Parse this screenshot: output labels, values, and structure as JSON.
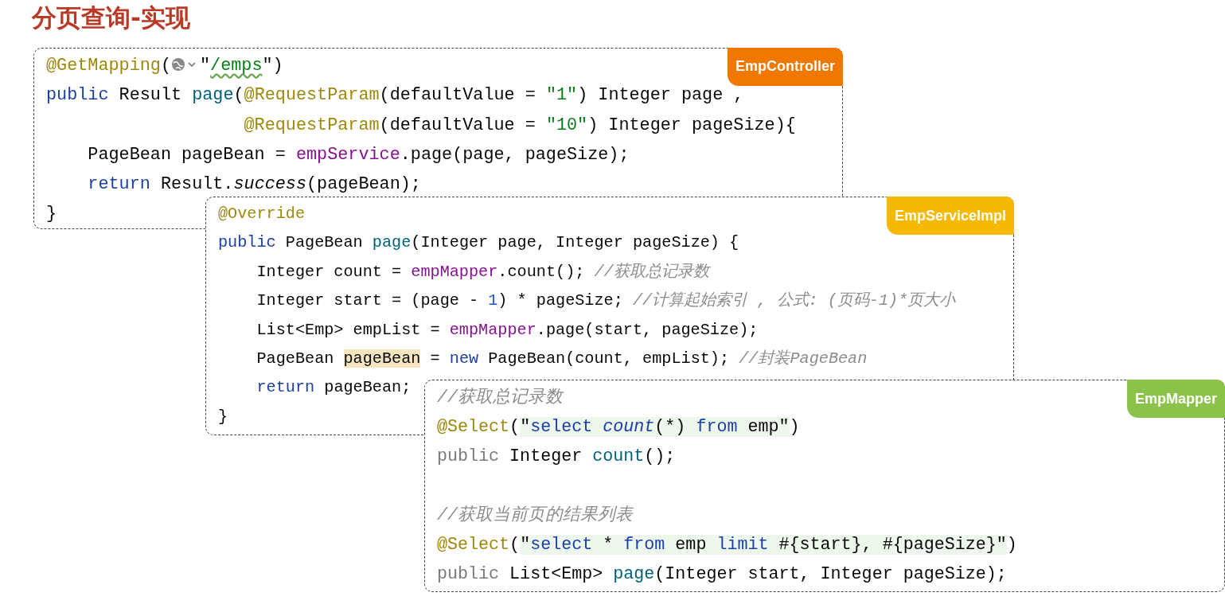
{
  "title": "分页查询-实现",
  "panels": [
    {
      "tag": "EmpController",
      "color": "#f07800",
      "lines": [
        {
          "kind": "code",
          "tokens": [
            {
              "kind": "ann",
              "text": "@GetMapping"
            },
            {
              "kind": "plain",
              "text": "("
            },
            {
              "kind": "globe"
            },
            {
              "kind": "plain",
              "text": "\""
            },
            {
              "kind": "url",
              "text": "/emps"
            },
            {
              "kind": "plain",
              "text": "\")"
            }
          ]
        },
        {
          "kind": "code",
          "tokens": [
            {
              "kind": "kw",
              "text": "public"
            },
            {
              "kind": "plain",
              "text": " Result "
            },
            {
              "kind": "fn",
              "text": "page"
            },
            {
              "kind": "plain",
              "text": "("
            },
            {
              "kind": "ann",
              "text": "@RequestParam"
            },
            {
              "kind": "plain",
              "text": "(defaultValue = "
            },
            {
              "kind": "str",
              "text": "\"1\""
            },
            {
              "kind": "plain",
              "text": ") Integer page ,"
            }
          ]
        },
        {
          "kind": "code",
          "tokens": [
            {
              "kind": "ann",
              "text": "                   @RequestParam"
            },
            {
              "kind": "plain",
              "text": "(defaultValue = "
            },
            {
              "kind": "str",
              "text": "\"10\""
            },
            {
              "kind": "plain",
              "text": ") Integer pageSize){"
            }
          ]
        },
        {
          "kind": "code",
          "tokens": [
            {
              "kind": "plain",
              "text": "    PageBean pageBean = "
            },
            {
              "kind": "field",
              "text": "empService"
            },
            {
              "kind": "plain",
              "text": ".page(page, pageSize);"
            }
          ]
        },
        {
          "kind": "code",
          "tokens": [
            {
              "kind": "kw",
              "text": "    return"
            },
            {
              "kind": "plain",
              "text": " Result."
            },
            {
              "kind": "italic",
              "text": "success"
            },
            {
              "kind": "plain",
              "text": "(pageBean);"
            }
          ]
        },
        {
          "kind": "code",
          "tokens": [
            {
              "kind": "plain",
              "text": "}"
            }
          ]
        }
      ]
    },
    {
      "tag": "EmpServiceImpl",
      "color": "#f6b800",
      "lines": [
        {
          "kind": "code",
          "tokens": [
            {
              "kind": "ann",
              "text": "@Override"
            }
          ]
        },
        {
          "kind": "code",
          "tokens": [
            {
              "kind": "kw",
              "text": "public"
            },
            {
              "kind": "plain",
              "text": " PageBean "
            },
            {
              "kind": "fn",
              "text": "page"
            },
            {
              "kind": "plain",
              "text": "(Integer page, Integer pageSize) {"
            }
          ]
        },
        {
          "kind": "code",
          "tokens": [
            {
              "kind": "plain",
              "text": "    Integer count = "
            },
            {
              "kind": "field",
              "text": "empMapper"
            },
            {
              "kind": "plain",
              "text": ".count(); "
            },
            {
              "kind": "cmt",
              "text": "//获取总记录数"
            }
          ]
        },
        {
          "kind": "code",
          "tokens": [
            {
              "kind": "plain",
              "text": "    Integer start = (page - "
            },
            {
              "kind": "num",
              "text": "1"
            },
            {
              "kind": "plain",
              "text": ") * pageSize; "
            },
            {
              "kind": "cmt",
              "text": "//计算起始索引 , 公式: (页码-1)*页大小"
            }
          ]
        },
        {
          "kind": "code",
          "tokens": [
            {
              "kind": "plain",
              "text": "    List<Emp> empList = "
            },
            {
              "kind": "field",
              "text": "empMapper"
            },
            {
              "kind": "plain",
              "text": ".page(start, pageSize);"
            }
          ]
        },
        {
          "kind": "code",
          "tokens": [
            {
              "kind": "plain",
              "text": "    PageBean "
            },
            {
              "kind": "var_hl",
              "text": "pageBean"
            },
            {
              "kind": "plain",
              "text": " = "
            },
            {
              "kind": "kw",
              "text": "new"
            },
            {
              "kind": "plain",
              "text": " PageBean(count, empList); "
            },
            {
              "kind": "cmt",
              "text": "//封装PageBean"
            }
          ]
        },
        {
          "kind": "code",
          "tokens": [
            {
              "kind": "kw",
              "text": "    return"
            },
            {
              "kind": "plain",
              "text": " pageBean;"
            }
          ]
        },
        {
          "kind": "code",
          "tokens": [
            {
              "kind": "plain",
              "text": "}"
            }
          ]
        }
      ]
    },
    {
      "tag": "EmpMapper",
      "color": "#8bc34a",
      "lines": [
        {
          "kind": "code",
          "tokens": [
            {
              "kind": "cmt",
              "text": "//获取总记录数"
            }
          ]
        },
        {
          "kind": "code",
          "tokens": [
            {
              "kind": "ann",
              "text": "@Select"
            },
            {
              "kind": "plain",
              "text": "("
            },
            {
              "kind": "plain",
              "text": "\"",
              "highlighted": true
            },
            {
              "kind": "kw",
              "text": "select ",
              "highlighted": true
            },
            {
              "kind": "sqlfn",
              "text": "count",
              "highlighted": true
            },
            {
              "kind": "plain",
              "text": "(*) ",
              "highlighted": true
            },
            {
              "kind": "kw",
              "text": "from",
              "highlighted": true
            },
            {
              "kind": "plain",
              "text": " emp\"",
              "highlighted": true
            },
            {
              "kind": "plain",
              "text": ")"
            }
          ]
        },
        {
          "kind": "code",
          "tokens": [
            {
              "kind": "dim",
              "text": "public"
            },
            {
              "kind": "plain",
              "text": " Integer "
            },
            {
              "kind": "fn",
              "text": "count"
            },
            {
              "kind": "plain",
              "text": "();"
            }
          ]
        },
        {
          "kind": "blank"
        },
        {
          "kind": "code",
          "tokens": [
            {
              "kind": "cmt",
              "text": "//获取当前页的结果列表"
            }
          ]
        },
        {
          "kind": "code",
          "tokens": [
            {
              "kind": "ann",
              "text": "@Select"
            },
            {
              "kind": "plain",
              "text": "("
            },
            {
              "kind": "plain",
              "text": "\"",
              "highlighted": true
            },
            {
              "kind": "kw",
              "text": "select",
              "highlighted": true
            },
            {
              "kind": "plain",
              "text": " * ",
              "highlighted": true
            },
            {
              "kind": "kw",
              "text": "from",
              "highlighted": true
            },
            {
              "kind": "plain",
              "text": " emp ",
              "highlighted": true
            },
            {
              "kind": "kw",
              "text": "limit",
              "highlighted": true
            },
            {
              "kind": "plain",
              "text": " #{start}, #{pageSize}\"",
              "highlighted": true
            },
            {
              "kind": "plain",
              "text": ")"
            }
          ]
        },
        {
          "kind": "code",
          "tokens": [
            {
              "kind": "dim",
              "text": "public"
            },
            {
              "kind": "plain",
              "text": " List<Emp> "
            },
            {
              "kind": "fn",
              "text": "page"
            },
            {
              "kind": "plain",
              "text": "(Integer start, Integer pageSize);"
            }
          ]
        }
      ]
    }
  ]
}
